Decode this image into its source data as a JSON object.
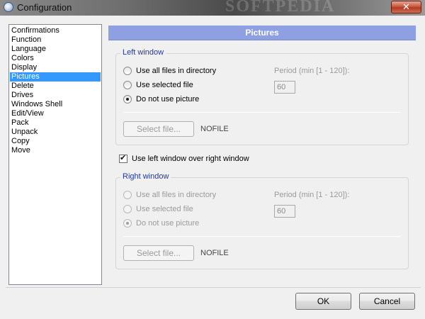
{
  "window": {
    "title": "Configuration",
    "watermark": "SOFTPEDIA",
    "close_glyph": "✕"
  },
  "sidebar": {
    "items": [
      {
        "label": "Confirmations"
      },
      {
        "label": "Function"
      },
      {
        "label": "Language"
      },
      {
        "label": "Colors"
      },
      {
        "label": "Display"
      },
      {
        "label": "Pictures",
        "selected": true
      },
      {
        "label": "Delete"
      },
      {
        "label": "Drives"
      },
      {
        "label": "Windows Shell"
      },
      {
        "label": "Edit/View"
      },
      {
        "label": "Pack"
      },
      {
        "label": "Unpack"
      },
      {
        "label": "Copy"
      },
      {
        "label": "Move"
      }
    ]
  },
  "panel": {
    "header": "Pictures"
  },
  "left_window": {
    "legend": "Left window",
    "options": [
      "Use all files in directory",
      "Use selected file",
      "Do not use picture"
    ],
    "selected_option": 2,
    "period_label": "Period (min [1 - 120]):",
    "period_value": "60",
    "select_button": "Select file...",
    "file_value": "NOFILE"
  },
  "use_left_checkbox": {
    "label": "Use left window over right window",
    "checked": true
  },
  "right_window": {
    "legend": "Right window",
    "options": [
      "Use all files in directory",
      "Use selected file",
      "Do not use picture"
    ],
    "selected_option": 2,
    "period_label": "Period (min [1 - 120]):",
    "period_value": "60",
    "select_button": "Select file...",
    "file_value": "NOFILE",
    "disabled": true
  },
  "footer": {
    "ok_label": "OK",
    "cancel_label": "Cancel"
  },
  "colors": {
    "header_bg": "#8ea0e2",
    "selection_bg": "#3399ff",
    "legend_text": "#1f3a99"
  }
}
